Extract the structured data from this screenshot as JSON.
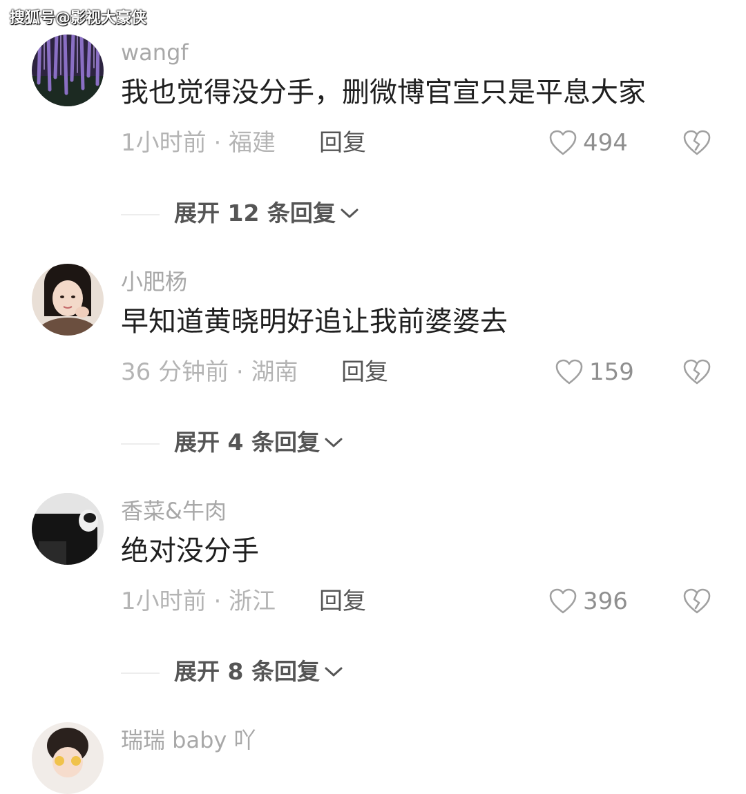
{
  "watermark": "搜狐号@影视大豪侠",
  "comments": [
    {
      "username": "wangf",
      "text": "我也觉得没分手，删微博官宣只是平息大家",
      "meta": "1小时前 · 福建",
      "reply_label": "回复",
      "likes": "494",
      "expand_label": "展开 12 条回复"
    },
    {
      "username": "小肥杨",
      "text": "早知道黄晓明好追让我前婆婆去",
      "meta": "36 分钟前 · 湖南",
      "reply_label": "回复",
      "likes": "159",
      "expand_label": "展开 4 条回复"
    },
    {
      "username": "香菜&牛肉",
      "text": "绝对没分手",
      "meta": "1小时前 · 浙江",
      "reply_label": "回复",
      "likes": "396",
      "expand_label": "展开 8 条回复"
    },
    {
      "username": "瑞瑞 baby 吖"
    }
  ],
  "icons": {
    "like": "heart-outline-icon",
    "dislike": "broken-heart-icon",
    "expand": "chevron-down-icon"
  },
  "colors": {
    "username": "#a8a8a8",
    "text": "#1f1f1f",
    "meta": "#b4b4b4",
    "secondary": "#555555"
  }
}
